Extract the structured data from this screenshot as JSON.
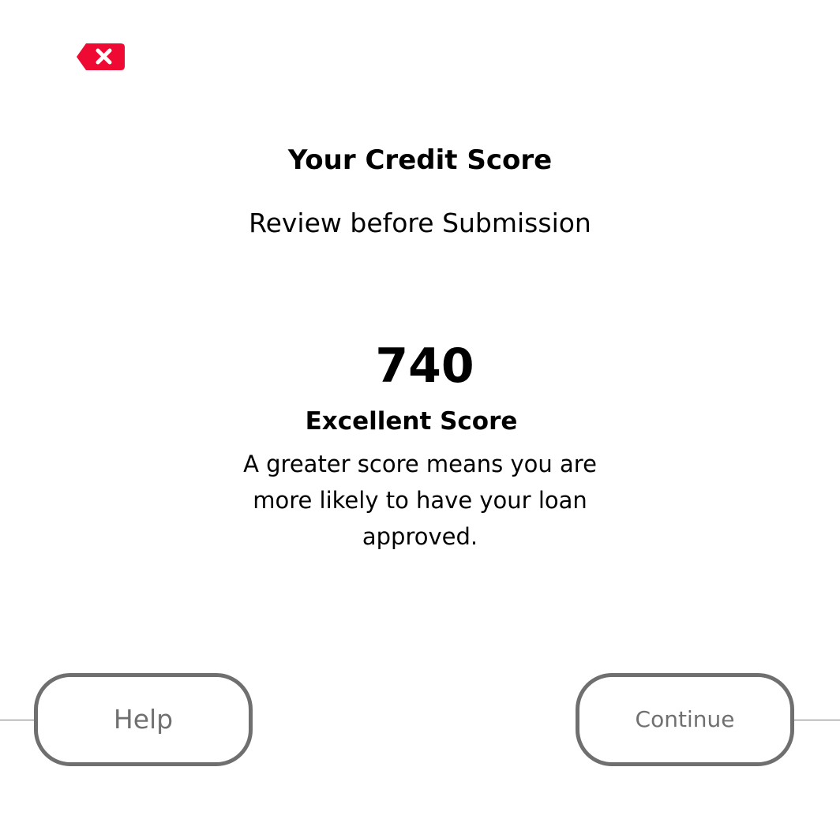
{
  "header": {
    "close_icon": "backspace-x-icon",
    "accent_color": "#ee0a32"
  },
  "content": {
    "title": "Your Credit Score",
    "subtitle": "Review before Submission",
    "score": "740",
    "score_label": "Excellent Score",
    "description": "A greater score means you are more likely to have your loan approved."
  },
  "actions": {
    "help_label": "Help",
    "continue_label": "Continue"
  }
}
